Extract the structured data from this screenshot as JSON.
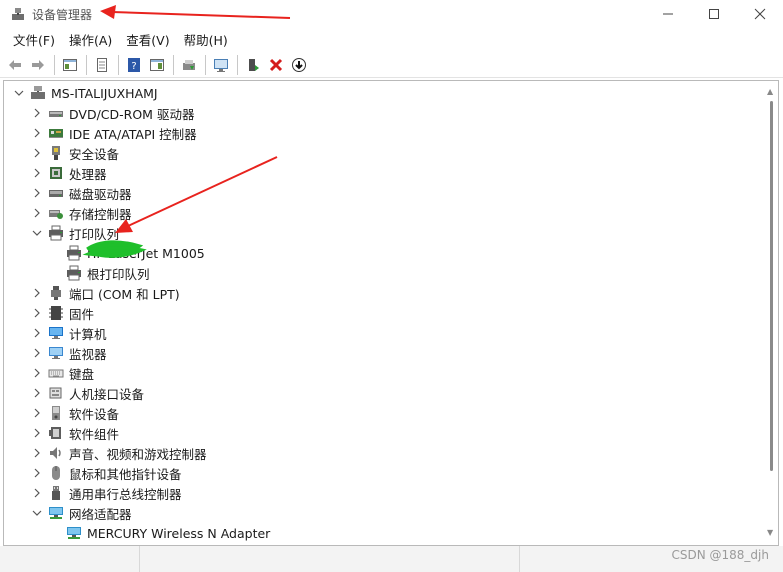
{
  "window": {
    "title": "设备管理器"
  },
  "menubar": {
    "items": [
      "文件(F)",
      "操作(A)",
      "查看(V)",
      "帮助(H)"
    ]
  },
  "tree": {
    "root": "MS-ITALIJUXHAMJ",
    "categories": [
      {
        "label": "DVD/CD-ROM 驱动器",
        "icon": "dvd-drive-icon",
        "expanded": false
      },
      {
        "label": "IDE ATA/ATAPI 控制器",
        "icon": "ide-controller-icon",
        "expanded": false
      },
      {
        "label": "安全设备",
        "icon": "security-device-icon",
        "expanded": false
      },
      {
        "label": "处理器",
        "icon": "processor-icon",
        "expanded": false
      },
      {
        "label": "磁盘驱动器",
        "icon": "disk-drive-icon",
        "expanded": false
      },
      {
        "label": "存储控制器",
        "icon": "storage-controller-icon",
        "expanded": false
      },
      {
        "label": "打印队列",
        "icon": "printer-icon",
        "expanded": true,
        "children": [
          {
            "label": "HP LaserJet M1005",
            "icon": "printer-icon"
          },
          {
            "label": "根打印队列",
            "icon": "printer-icon"
          }
        ]
      },
      {
        "label": "端口 (COM 和 LPT)",
        "icon": "port-icon",
        "expanded": false
      },
      {
        "label": "固件",
        "icon": "firmware-icon",
        "expanded": false
      },
      {
        "label": "计算机",
        "icon": "computer-icon",
        "expanded": false
      },
      {
        "label": "监视器",
        "icon": "monitor-icon",
        "expanded": false
      },
      {
        "label": "键盘",
        "icon": "keyboard-icon",
        "expanded": false
      },
      {
        "label": "人机接口设备",
        "icon": "hid-icon",
        "expanded": false
      },
      {
        "label": "软件设备",
        "icon": "software-device-icon",
        "expanded": false
      },
      {
        "label": "软件组件",
        "icon": "software-component-icon",
        "expanded": false
      },
      {
        "label": "声音、视频和游戏控制器",
        "icon": "sound-icon",
        "expanded": false
      },
      {
        "label": "鼠标和其他指针设备",
        "icon": "mouse-icon",
        "expanded": false
      },
      {
        "label": "通用串行总线控制器",
        "icon": "usb-icon",
        "expanded": false
      },
      {
        "label": "网络适配器",
        "icon": "network-adapter-icon",
        "expanded": true,
        "children": [
          {
            "label": "MERCURY Wireless N Adapter",
            "icon": "network-adapter-icon"
          }
        ]
      }
    ]
  },
  "watermark": "CSDN @188_djh",
  "colors": {
    "annotation": "#e8231e",
    "scribble": "#1fbf2b",
    "accent": "#0b6fc4"
  }
}
